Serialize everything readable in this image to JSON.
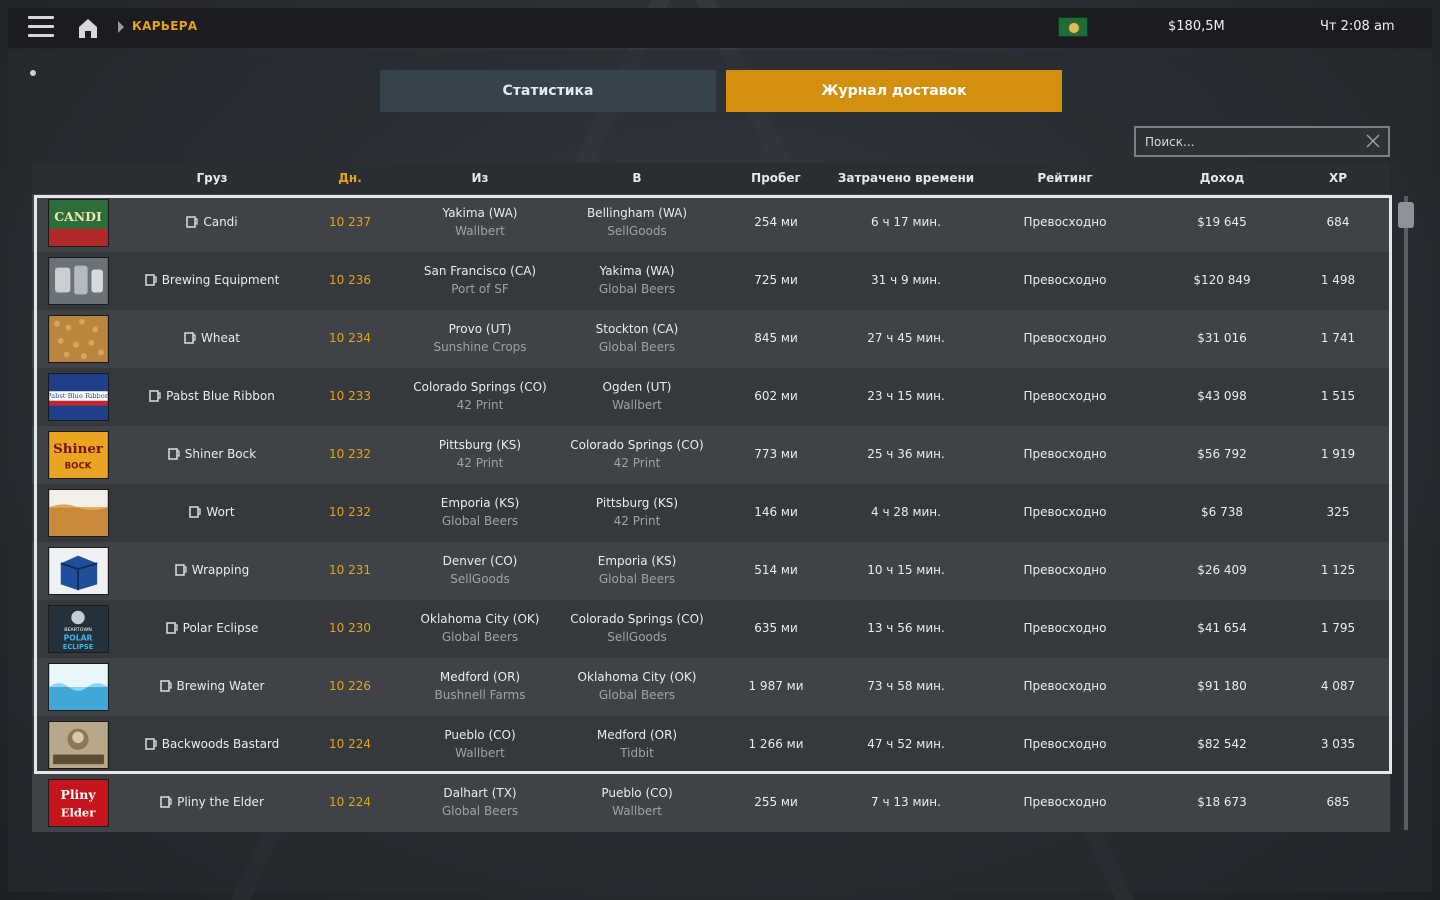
{
  "topbar": {
    "breadcrumb": "КАРЬЕРА",
    "money": "$180,5M",
    "time": "Чт 2:08 am"
  },
  "tabs": [
    {
      "label": "Статистика",
      "active": false
    },
    {
      "label": "Журнал доставок",
      "active": true
    }
  ],
  "search": {
    "placeholder": "Поиск..."
  },
  "columns": {
    "cargo": "Груз",
    "day": "Дн.",
    "from": "Из",
    "to": "В",
    "distance": "Пробег",
    "time": "Затрачено времени",
    "rating": "Рейтинг",
    "income": "Доход",
    "xp": "XP"
  },
  "colors": {
    "accent": "#e8a418",
    "tab_active": "#d38f0e",
    "tab_inactive": "#36434d"
  },
  "rows": [
    {
      "cargo": "Candi",
      "day": "10 237",
      "from_city": "Yakima (WA)",
      "from_company": "Wallbert",
      "to_city": "Bellingham (WA)",
      "to_company": "SellGoods",
      "distance": "254 ми",
      "time": "6 ч 17 мин.",
      "rating": "Превосходно",
      "income": "$19 645",
      "xp": "684"
    },
    {
      "cargo": "Brewing Equipment",
      "day": "10 236",
      "from_city": "San Francisco (CA)",
      "from_company": "Port of SF",
      "to_city": "Yakima (WA)",
      "to_company": "Global Beers",
      "distance": "725 ми",
      "time": "31 ч 9 мин.",
      "rating": "Превосходно",
      "income": "$120 849",
      "xp": "1 498"
    },
    {
      "cargo": "Wheat",
      "day": "10 234",
      "from_city": "Provo (UT)",
      "from_company": "Sunshine Crops",
      "to_city": "Stockton (CA)",
      "to_company": "Global Beers",
      "distance": "845 ми",
      "time": "27 ч 45 мин.",
      "rating": "Превосходно",
      "income": "$31 016",
      "xp": "1 741"
    },
    {
      "cargo": "Pabst Blue Ribbon",
      "day": "10 233",
      "from_city": "Colorado Springs (CO)",
      "from_company": "42 Print",
      "to_city": "Ogden (UT)",
      "to_company": "Wallbert",
      "distance": "602 ми",
      "time": "23 ч 15 мин.",
      "rating": "Превосходно",
      "income": "$43 098",
      "xp": "1 515"
    },
    {
      "cargo": "Shiner Bock",
      "day": "10 232",
      "from_city": "Pittsburg (KS)",
      "from_company": "42 Print",
      "to_city": "Colorado Springs (CO)",
      "to_company": "42 Print",
      "distance": "773 ми",
      "time": "25 ч 36 мин.",
      "rating": "Превосходно",
      "income": "$56 792",
      "xp": "1 919"
    },
    {
      "cargo": "Wort",
      "day": "10 232",
      "from_city": "Emporia (KS)",
      "from_company": "Global Beers",
      "to_city": "Pittsburg (KS)",
      "to_company": "42 Print",
      "distance": "146 ми",
      "time": "4 ч 28 мин.",
      "rating": "Превосходно",
      "income": "$6 738",
      "xp": "325"
    },
    {
      "cargo": "Wrapping",
      "day": "10 231",
      "from_city": "Denver (CO)",
      "from_company": "SellGoods",
      "to_city": "Emporia (KS)",
      "to_company": "Global Beers",
      "distance": "514 ми",
      "time": "10 ч 15 мин.",
      "rating": "Превосходно",
      "income": "$26 409",
      "xp": "1 125"
    },
    {
      "cargo": "Polar Eclipse",
      "day": "10 230",
      "from_city": "Oklahoma City (OK)",
      "from_company": "Global Beers",
      "to_city": "Colorado Springs (CO)",
      "to_company": "SellGoods",
      "distance": "635 ми",
      "time": "13 ч 56 мин.",
      "rating": "Превосходно",
      "income": "$41 654",
      "xp": "1 795"
    },
    {
      "cargo": "Brewing Water",
      "day": "10 226",
      "from_city": "Medford (OR)",
      "from_company": "Bushnell Farms",
      "to_city": "Oklahoma City (OK)",
      "to_company": "Global Beers",
      "distance": "1 987 ми",
      "time": "73 ч 58 мин.",
      "rating": "Превосходно",
      "income": "$91 180",
      "xp": "4 087"
    },
    {
      "cargo": "Backwoods Bastard",
      "day": "10 224",
      "from_city": "Pueblo (CO)",
      "from_company": "Wallbert",
      "to_city": "Medford (OR)",
      "to_company": "Tidbit",
      "distance": "1 266 ми",
      "time": "47 ч 52 мин.",
      "rating": "Превосходно",
      "income": "$82 542",
      "xp": "3 035"
    },
    {
      "cargo": "Pliny the Elder",
      "day": "10 224",
      "from_city": "Dalhart (TX)",
      "from_company": "Global Beers",
      "to_city": "Pueblo (CO)",
      "to_company": "Wallbert",
      "distance": "255 ми",
      "time": "7 ч 13 мин.",
      "rating": "Превосходно",
      "income": "$18 673",
      "xp": "685"
    }
  ],
  "thumbnails": {
    "candi": "CANDI",
    "pabst": "Pabst Blue Ribbon",
    "shiner": "Shiner BOCK",
    "polar": "BEARTOWN POLAR ECLIPSE",
    "backwoods": "BACKWOODS BASTARD",
    "pliny": "Pliny the Elder"
  }
}
